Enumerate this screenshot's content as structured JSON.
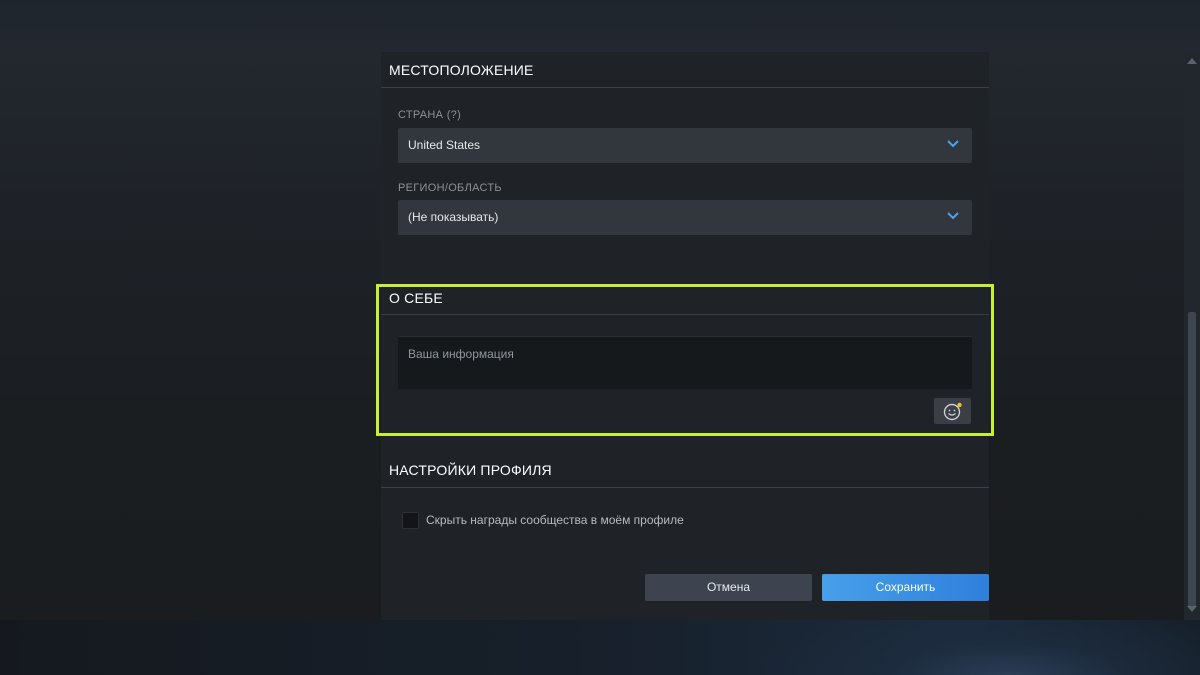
{
  "location_section": {
    "title": "МЕСТОПОЛОЖЕНИЕ",
    "country_label": "СТРАНА",
    "country_help": "(?)",
    "country_value": "United States",
    "region_label": "РЕГИОН/ОБЛАСТЬ",
    "region_value": "(Не показывать)"
  },
  "about_section": {
    "title": "О СЕБЕ",
    "summary_placeholder": "Ваша информация",
    "emoji_icon": "smiley-icon"
  },
  "profile_settings_section": {
    "title": "НАСТРОЙКИ ПРОФИЛЯ",
    "hide_awards_label": "Скрыть награды сообщества в моём профиле",
    "hide_awards_checked": false
  },
  "actions": {
    "cancel_label": "Отмена",
    "save_label": "Сохранить"
  },
  "colors": {
    "highlight": "#c7f034",
    "save_button": "#3b8ee3",
    "select_chevron": "#4aa3ef",
    "emoji_badge": "#f5c022"
  }
}
